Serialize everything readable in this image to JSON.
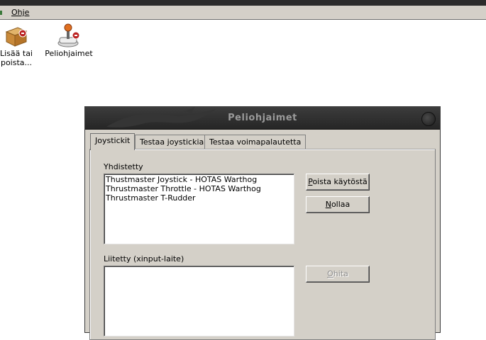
{
  "menubar": {
    "help_label": "Ohje"
  },
  "desktop": {
    "icons": [
      {
        "label_line1": "Lisää tai",
        "label_line2": "poista..."
      },
      {
        "label": "Peliohjaimet"
      }
    ]
  },
  "dialog": {
    "title": "Peliohjaimet",
    "tabs": [
      {
        "label": "Joystickit",
        "active": true
      },
      {
        "label": "Testaa joystickia",
        "active": false
      },
      {
        "label": "Testaa voimapalautetta",
        "active": false
      }
    ],
    "connected": {
      "label": "Yhdistetty",
      "items": [
        "Thustmaster Joystick - HOTAS Warthog",
        "Thrustmaster Throttle - HOTAS Warthog",
        "Thrustmaster T-Rudder"
      ]
    },
    "xinput": {
      "label": "Liitetty (xinput-laite)",
      "items": []
    },
    "buttons": {
      "disable": "Poista käytöstä",
      "reset": "Nollaa",
      "skip": "Ohita"
    }
  }
}
